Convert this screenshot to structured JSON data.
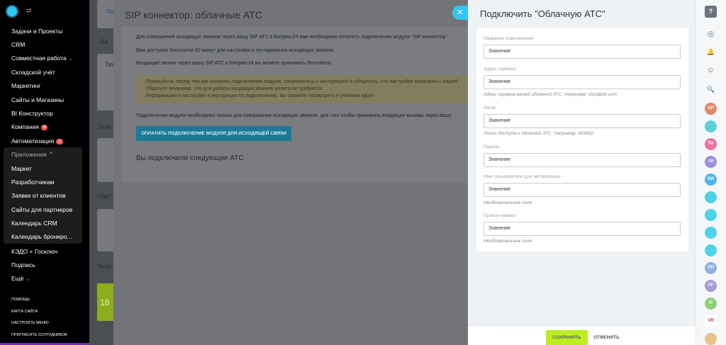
{
  "sidebar": {
    "items": [
      {
        "label": "Задачи и Проекты"
      },
      {
        "label": "CRM"
      },
      {
        "label": "Совместная работа"
      },
      {
        "label": "Складской учёт"
      },
      {
        "label": "Маркетинг"
      },
      {
        "label": "Сайты и Магазины"
      },
      {
        "label": "BI Конструктор"
      },
      {
        "label": "Компания",
        "badge": "4"
      },
      {
        "label": "Автоматизация",
        "badge": "1"
      },
      {
        "label": "Приложения"
      },
      {
        "label": "Маркет"
      },
      {
        "label": "Разработчикам"
      },
      {
        "label": "Заявки от клиентов"
      },
      {
        "label": "Сайты для партнеров"
      },
      {
        "label": "Календарь CRM"
      },
      {
        "label": "Календарь брониро..."
      },
      {
        "label": "КЭДО + Госключ"
      },
      {
        "label": "Подпись"
      },
      {
        "label": "Ещё"
      }
    ],
    "footer_links": [
      "ПОМОЩЬ",
      "КАРТА САЙТА",
      "НАСТРОИТЬ МЕНЮ",
      "ПРИГЛАСИТЬ СОТРУДНИКОВ"
    ]
  },
  "background": {
    "tab": "По",
    "labels": [
      "Ва",
      "Тел",
      "Теле",
      "Наст",
      "Теле",
      "18"
    ]
  },
  "sip": {
    "title": "SIP коннектор: облачные АТС",
    "line1": "Для совершения исходящих звонков через вашу SIP АТС в Битрикс24 вам необходимо оплатить подключение модуля \"SIP коннектор\".",
    "line2": "Вам доступно бесплатно 60 минут для настройки и тестирования исходящих звонков.",
    "line3": "Входящие звонки через вашу SIP АТС в Битрикс24 вы можете принимать бесплатно.",
    "warning": [
      "Пожалуйста, перед тем как оплатить подключение модуля, ознакомьтесь с инструкцией и убедитесь, что настройки возможны с вашей",
      "Обратите внимание, что для работы входящих звонков оплата не требуется.",
      "Информацию о настройке и инструкции по подключению, вы сможете посмотреть в учебном курсе."
    ],
    "note": "Подключение модуля необходимо только для совершения исходящих звонков, для того чтобы принимать входящие вызовы через вашу",
    "pay_button": "ОПЛАТИТЬ ПОДКЛЮЧЕНИЕ МОДУЛЯ ДЛЯ ИСХОДЯЩЕЙ СВЯЗИ",
    "connected_title": "Вы подключили следующие АТС",
    "close_label": "✕"
  },
  "form": {
    "title": "Подключить \"Облачную АТС\"",
    "fields": [
      {
        "label": "Название подключения",
        "value": "Значение",
        "hint": ""
      },
      {
        "label": "Адрес сервера",
        "value": "Значение",
        "hint": "Адрес сервера вашей облачной АТС. Например: cloudpbx.com"
      },
      {
        "label": "Логин",
        "value": "Значение",
        "hint": "Логин доступа к облачной АТС. Например: 003452"
      },
      {
        "label": "Пароль",
        "value": "Значение",
        "hint": ""
      },
      {
        "label": "Имя пользователя для авторизации",
        "value": "Значение",
        "hint": "Необязательное поле"
      },
      {
        "label": "Прокси-сервер",
        "value": "Значение",
        "hint": "Необязательное поле"
      }
    ],
    "save_label": "СОХРАНИТЬ",
    "cancel_label": "ОТМЕНИТЬ"
  },
  "right_column": {
    "glyphs": [
      "?",
      "◎",
      "🔔",
      "☺",
      "🔍"
    ],
    "avatars": [
      {
        "initials": "ОП",
        "color": "#e0876a"
      },
      {
        "initials": "",
        "color": "#5ed0d6"
      },
      {
        "initials": "ТИ",
        "color": "#ee6fa6"
      },
      {
        "initials": "АК",
        "color": "#9a8fe0"
      },
      {
        "initials": "ВИ",
        "color": "#4fb6f0"
      },
      {
        "initials": "",
        "color": "#4fd2e8"
      },
      {
        "initials": "",
        "color": "#4fd2e8"
      },
      {
        "initials": "",
        "color": "#4fd2e8"
      },
      {
        "initials": "",
        "color": "#4fd2e8"
      },
      {
        "initials": "ПП",
        "color": "#8fb0e0"
      },
      {
        "initials": "ПГ",
        "color": "#a89cd8"
      },
      {
        "initials": "П",
        "color": "#8fcf7a"
      },
      {
        "initials": "VR",
        "color": "#ffffff"
      },
      {
        "initials": "",
        "color": "#e6c48a"
      }
    ]
  }
}
